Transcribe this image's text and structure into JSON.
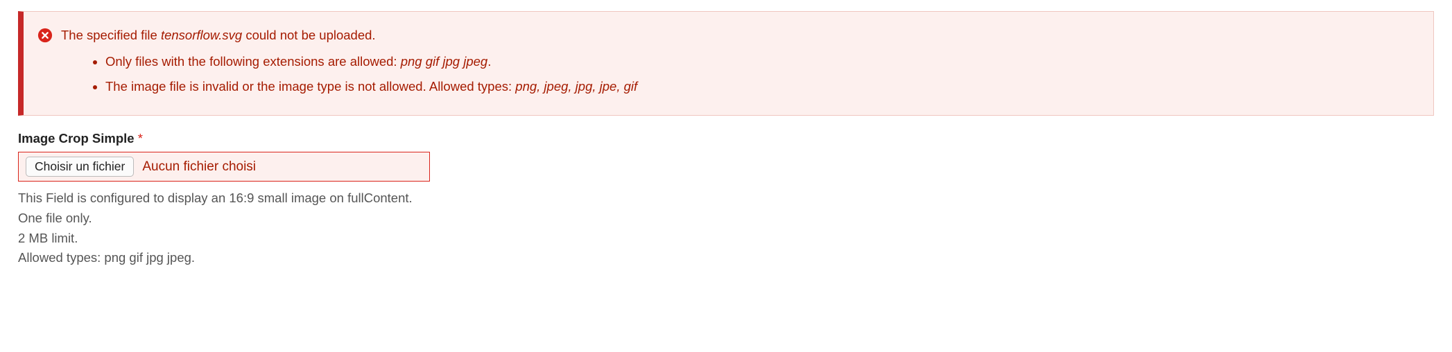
{
  "error": {
    "title_prefix": "The specified file ",
    "title_filename": "tensorflow.svg",
    "title_suffix": " could not be uploaded.",
    "items": [
      {
        "prefix": "Only files with the following extensions are allowed: ",
        "emph": "png gif jpg jpeg",
        "suffix": "."
      },
      {
        "prefix": "The image file is invalid or the image type is not allowed. Allowed types: ",
        "emph": "png, jpeg, jpg, jpe, gif",
        "suffix": ""
      }
    ]
  },
  "field": {
    "label": "Image Crop Simple",
    "required_marker": "*",
    "choose_button": "Choisir un fichier",
    "no_file_text": "Aucun fichier choisi",
    "help_line1": "This Field is configured to display an 16:9 small image on fullContent.",
    "help_line2": "One file only.",
    "help_line3": "2 MB limit.",
    "help_line4": "Allowed types: png gif jpg jpeg."
  }
}
